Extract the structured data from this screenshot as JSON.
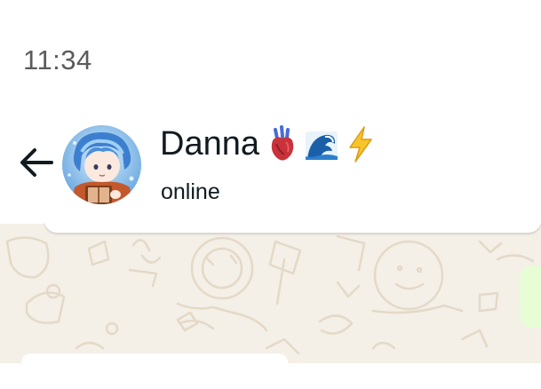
{
  "status_bar": {
    "time": "11:34"
  },
  "header": {
    "back_icon": "arrow-left-icon",
    "contact_name": "Danna",
    "name_emojis": [
      "anatomical-heart-icon",
      "water-wave-icon",
      "lightning-icon"
    ],
    "status": "online"
  },
  "colors": {
    "header_bg": "#ffffff",
    "chat_bg": "#f4efe7",
    "wallpaper_line": "#e4d9c7",
    "outgoing_bubble": "#e7fdd6",
    "text_primary": "#111b21",
    "text_time": "#5b5b5b"
  }
}
